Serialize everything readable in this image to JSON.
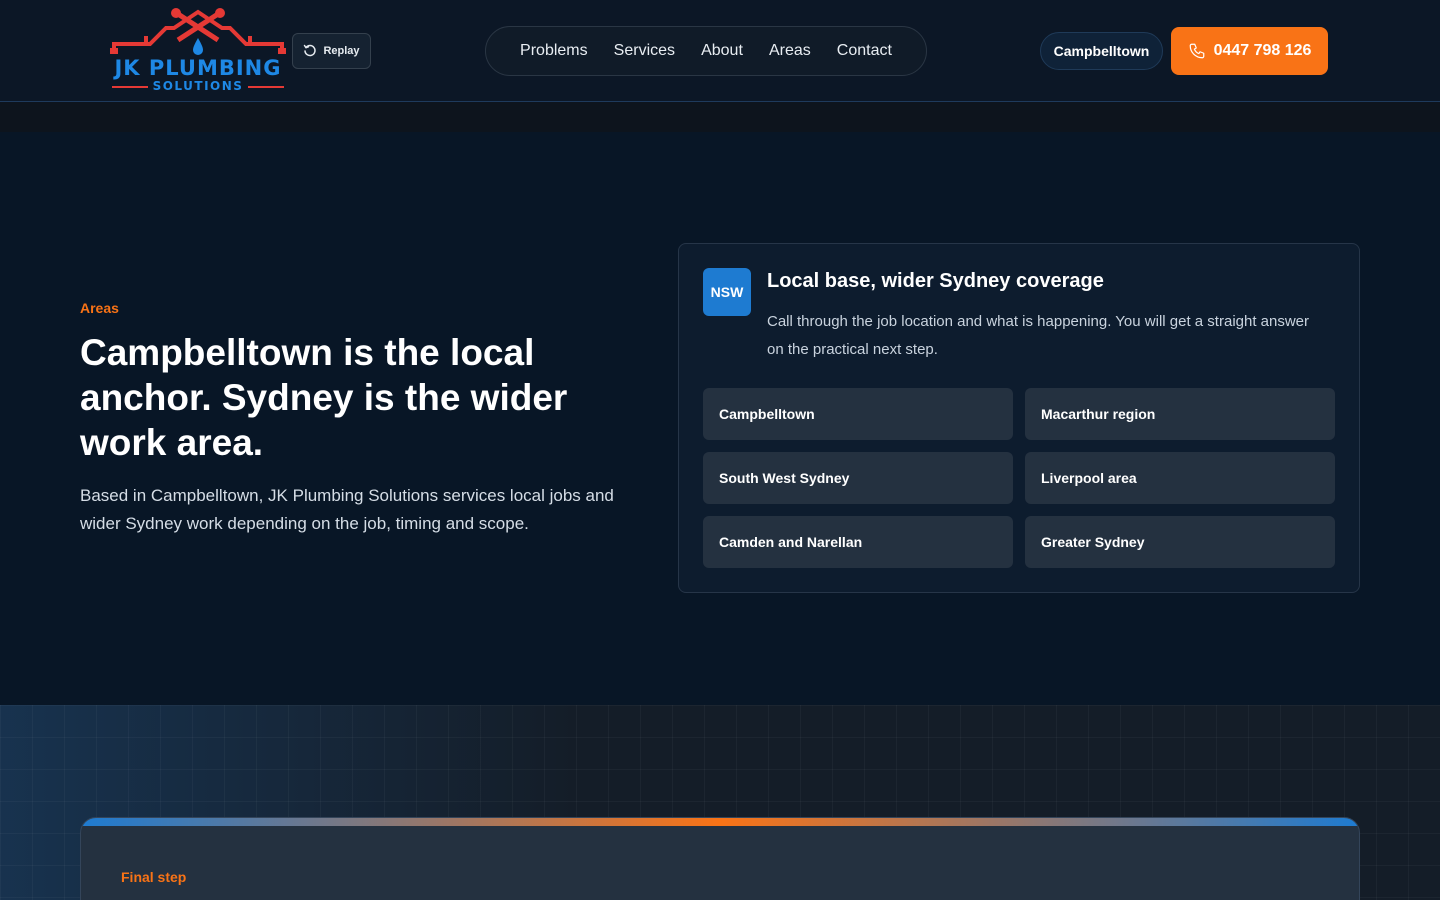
{
  "header": {
    "logo": {
      "brand": "JK PLUMBING",
      "sub": "SOLUTIONS",
      "icon": "house-pipe-logo"
    },
    "replay_label": "Replay",
    "nav": [
      "Problems",
      "Services",
      "About",
      "Areas",
      "Contact"
    ],
    "location_label": "Campbelltown",
    "phone_label": "0447 798 126"
  },
  "hero": {
    "eyebrow": "Areas",
    "title": "Campbelltown is the local anchor. Sydney is the wider work area.",
    "description": "Based in Campbelltown, JK Plumbing Solutions services local jobs and wider Sydney work depending on the job, timing and scope."
  },
  "card": {
    "badge": "NSW",
    "title": "Local base, wider Sydney coverage",
    "description": "Call through the job location and what is happening. You will get a straight answer on the practical next step.",
    "areas": [
      "Campbelltown",
      "Macarthur region",
      "South West Sydney",
      "Liverpool area",
      "Camden and Narellan",
      "Greater Sydney"
    ]
  },
  "final": {
    "eyebrow": "Final step"
  },
  "colors": {
    "accent_orange": "#f97316",
    "accent_blue": "#1e7bd1",
    "logo_red": "#e53935",
    "background": "#081626"
  }
}
